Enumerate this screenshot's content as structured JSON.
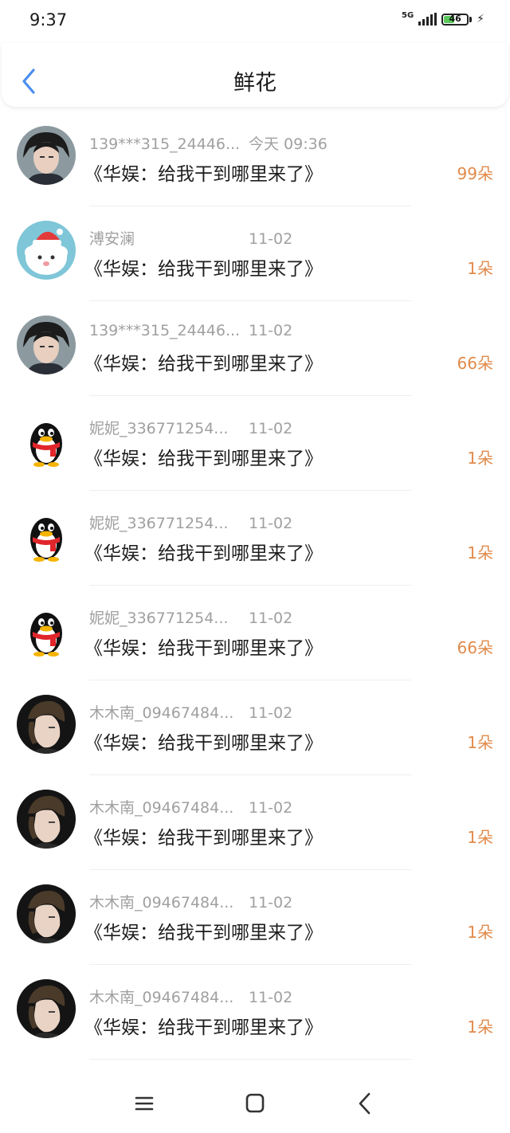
{
  "status_bar": {
    "time": "9:37",
    "network": "5G",
    "battery": "46",
    "battery_level": 0.46
  },
  "header": {
    "title": "鲜花"
  },
  "flowers": [
    {
      "name": "139***315_24446...",
      "time": "今天 09:36",
      "book": "《华娱：给我干到哪里来了》",
      "amount": "99朵",
      "avatar": "man-avatar"
    },
    {
      "name": "溥安澜",
      "time": "11-02",
      "book": "《华娱：给我干到哪里来了》",
      "amount": "1朵",
      "avatar": "sheep-avatar"
    },
    {
      "name": "139***315_24446...",
      "time": "11-02",
      "book": "《华娱：给我干到哪里来了》",
      "amount": "66朵",
      "avatar": "man-avatar"
    },
    {
      "name": "妮妮_336771254...",
      "time": "11-02",
      "book": "《华娱：给我干到哪里来了》",
      "amount": "1朵",
      "avatar": "penguin-avatar"
    },
    {
      "name": "妮妮_336771254...",
      "time": "11-02",
      "book": "《华娱：给我干到哪里来了》",
      "amount": "1朵",
      "avatar": "penguin-avatar"
    },
    {
      "name": "妮妮_336771254...",
      "time": "11-02",
      "book": "《华娱：给我干到哪里来了》",
      "amount": "66朵",
      "avatar": "penguin-avatar"
    },
    {
      "name": "木木南_09467484...",
      "time": "11-02",
      "book": "《华娱：给我干到哪里来了》",
      "amount": "1朵",
      "avatar": "profile-avatar"
    },
    {
      "name": "木木南_09467484...",
      "time": "11-02",
      "book": "《华娱：给我干到哪里来了》",
      "amount": "1朵",
      "avatar": "profile-avatar"
    },
    {
      "name": "木木南_09467484...",
      "time": "11-02",
      "book": "《华娱：给我干到哪里来了》",
      "amount": "1朵",
      "avatar": "profile-avatar"
    },
    {
      "name": "木木南_09467484...",
      "time": "11-02",
      "book": "《华娱：给我干到哪里来了》",
      "amount": "1朵",
      "avatar": "profile-avatar"
    }
  ],
  "navbar": {
    "icons": [
      "menu-icon",
      "home-icon",
      "back-icon"
    ]
  },
  "colors": {
    "accent": "#4a8ef0",
    "amount": "#e18a4a",
    "meta": "#a0a0a0"
  }
}
